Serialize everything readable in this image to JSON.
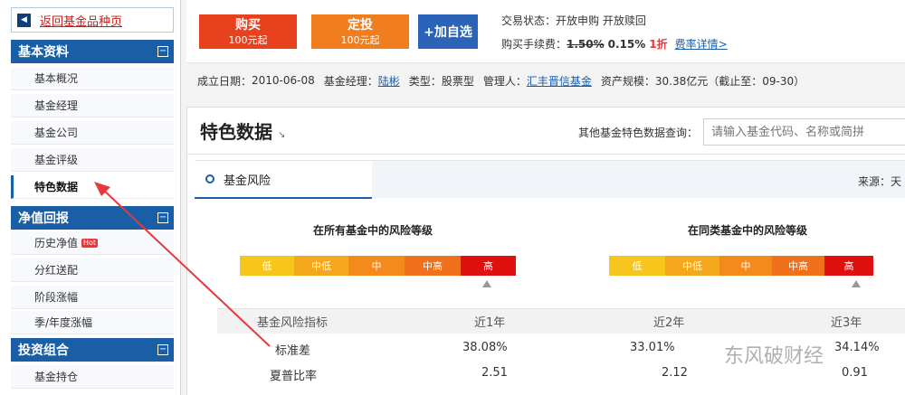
{
  "sidebar": {
    "back_label": "返回基金品种页",
    "sections": [
      {
        "title": "基本资料",
        "items": [
          "基本概况",
          "基金经理",
          "基金公司",
          "基金评级",
          "特色数据"
        ]
      },
      {
        "title": "净值回报",
        "items": [
          "历史净值",
          "分红送配",
          "阶段涨幅",
          "季/年度涨幅"
        ]
      },
      {
        "title": "投资组合",
        "items": [
          "基金持仓"
        ]
      }
    ],
    "toggle": "⊟",
    "hot_badge": "Hot",
    "active_item": "特色数据"
  },
  "topbar": {
    "buy_label": "购买",
    "buy_sub": "100元起",
    "invest_label": "定投",
    "invest_sub": "100元起",
    "watch_label": "+加自选",
    "trade_status": "交易状态：开放申购  开放赎回",
    "fee_prefix": "购买手续费：",
    "fee_old": "1.50%",
    "fee_new": "0.15%",
    "fee_discount": "1折",
    "fee_link": "费率详情>"
  },
  "fund_info": {
    "est_label": "成立日期：",
    "est_date": "2010-06-08",
    "manager_label": "基金经理：",
    "manager": "陆彬",
    "type_label": "类型：",
    "type": "股票型",
    "company_label": "管理人：",
    "company": "汇丰晋信基金",
    "size_label": "资产规模：",
    "size": "30.38亿元（截止至：09-30）"
  },
  "feature": {
    "title": "特色数据",
    "title_arrow": "↘",
    "query_label": "其他基金特色数据查询：",
    "query_placeholder": "请输入基金代码、名称或简拼",
    "risk_tab": "基金风险",
    "source_label": "来源：天",
    "all_title": "在所有基金中的风险等级",
    "same_title": "在同类基金中的风险等级",
    "levels": [
      "低",
      "中低",
      "中",
      "中高",
      "高"
    ],
    "risk_level_index": 4
  },
  "metrics": {
    "columns": [
      "基金风险指标",
      "近1年",
      "近2年",
      "近3年"
    ],
    "rows": [
      {
        "name": "标准差",
        "y1": "38.08%",
        "y2": "33.01%",
        "y3": "34.14%"
      },
      {
        "name": "夏普比率",
        "y1": "2.51",
        "y2": "2.12",
        "y3": "0.91"
      }
    ]
  },
  "watermark": "东风破财经",
  "colors": {
    "primary": "#1a5ea6",
    "buy": "#e8411e",
    "invest": "#f07d1e",
    "high_risk": "#e01010",
    "arrow": "#e8383d"
  }
}
